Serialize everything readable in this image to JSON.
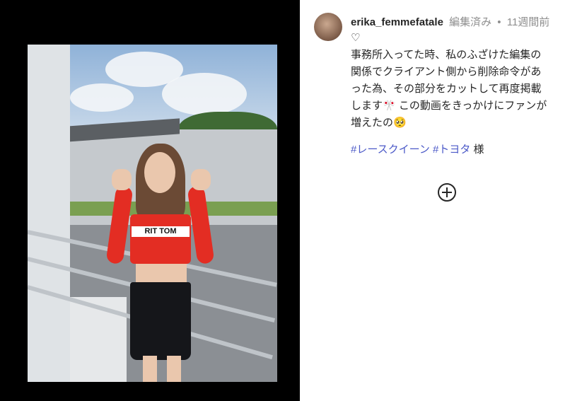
{
  "post": {
    "username": "erika_femmefatale",
    "edited_label": "編集済み",
    "separator": "•",
    "time_ago": "11週間前",
    "caption_lines": [
      "♡",
      "事務所入ってた時、私のふざけた編集の",
      "関係でクライアント側から削除命令があ",
      "った為、その部分をカットして再度掲載",
      "します🎌 この動画をきっかけにファンが",
      "増えたの🥺"
    ],
    "hashtag_1": "#レースクイーン",
    "hashtag_2": "#トヨタ",
    "hashtag_suffix": "様",
    "shirt_text": "RIT TOM"
  },
  "icons": {
    "load_more": "plus-circle-icon",
    "avatar": "avatar"
  },
  "colors": {
    "hashtag": "#4c5ac8",
    "meta": "#8e8e8e",
    "text": "#262626",
    "background_left": "#000000"
  }
}
